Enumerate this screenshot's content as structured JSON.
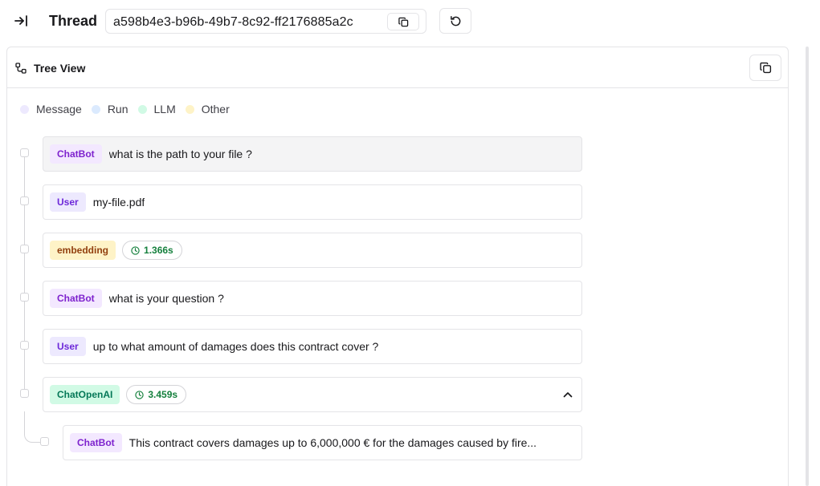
{
  "header": {
    "title": "Thread",
    "thread_id": "a598b4e3-b96b-49b7-8c92-ff2176885a2c"
  },
  "panel": {
    "title": "Tree View"
  },
  "legend": [
    {
      "label": "Message",
      "color": "#ede9fe"
    },
    {
      "label": "Run",
      "color": "#dbeafe"
    },
    {
      "label": "LLM",
      "color": "#d1fae5"
    },
    {
      "label": "Other",
      "color": "#fef3c7"
    }
  ],
  "steps": [
    {
      "badge": "ChatBot",
      "text": "what is the path to your file ?"
    },
    {
      "badge": "User",
      "text": "my-file.pdf"
    },
    {
      "badge": "embedding",
      "duration": "1.366s"
    },
    {
      "badge": "ChatBot",
      "text": "what is your question ?"
    },
    {
      "badge": "User",
      "text": "up to what amount of damages does this contract cover ?"
    },
    {
      "badge": "ChatOpenAI",
      "duration": "3.459s",
      "expanded": true,
      "children": [
        {
          "badge": "ChatBot",
          "text": "This contract covers damages up to 6,000,000 € for the damages caused by fire..."
        }
      ]
    }
  ],
  "icons": {
    "collapse": "arrow-right-to-line-icon",
    "copy": "copy-icon",
    "refresh": "refresh-icon",
    "tree": "tree-icon",
    "clock": "clock-icon",
    "chevron": "chevron-up-icon"
  }
}
